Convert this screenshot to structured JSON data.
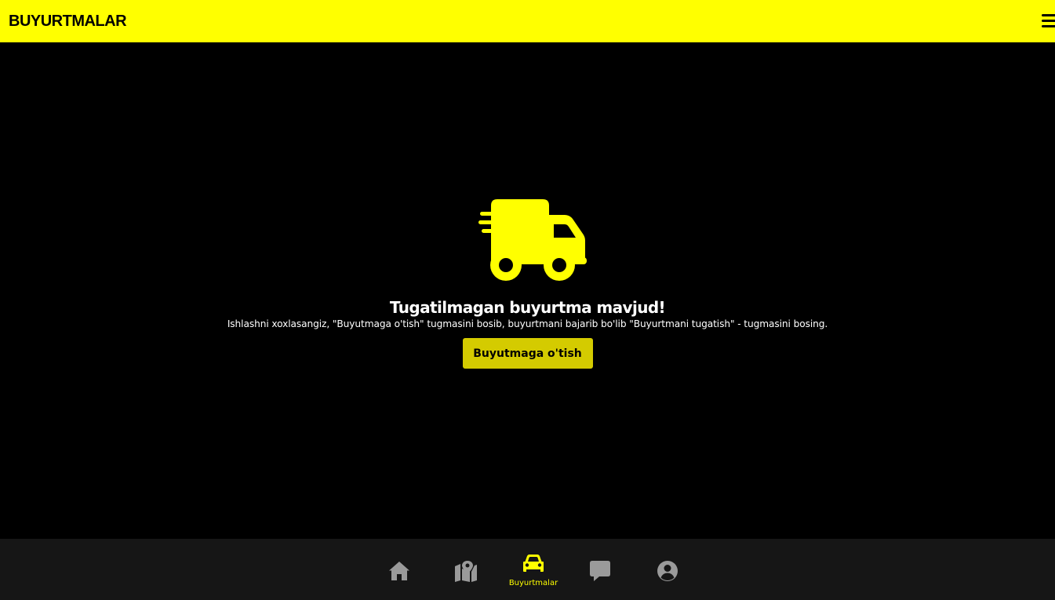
{
  "header": {
    "title": "BUYURTMALAR",
    "menu_icon": "hamburger-menu-icon"
  },
  "empty_state": {
    "icon": "shipping-fast-truck-icon",
    "headline": "Tugatilmagan buyurtma mavjud!",
    "description": "Ishlashni xoxlasangiz, \"Buyutmaga o'tish\" tugmasini bosib, buyurtmani bajarib bo'lib \"Buyurtmani tugatish\" - tugmasini bosing.",
    "button_label": "Buyutmaga o'tish"
  },
  "bottom_nav": {
    "items": [
      {
        "icon": "home-icon",
        "label": "",
        "active": false
      },
      {
        "icon": "map-marker-icon",
        "label": "",
        "active": false
      },
      {
        "icon": "car-icon",
        "label": "Buyurtmalar",
        "active": true
      },
      {
        "icon": "chat-icon",
        "label": "",
        "active": false
      },
      {
        "icon": "user-circle-icon",
        "label": "",
        "active": false
      }
    ]
  },
  "colors": {
    "accent": "#ffff00",
    "button": "#d4cb00",
    "background": "#000000",
    "nav_background": "#161616",
    "nav_icon_inactive": "#9a9a9a"
  }
}
